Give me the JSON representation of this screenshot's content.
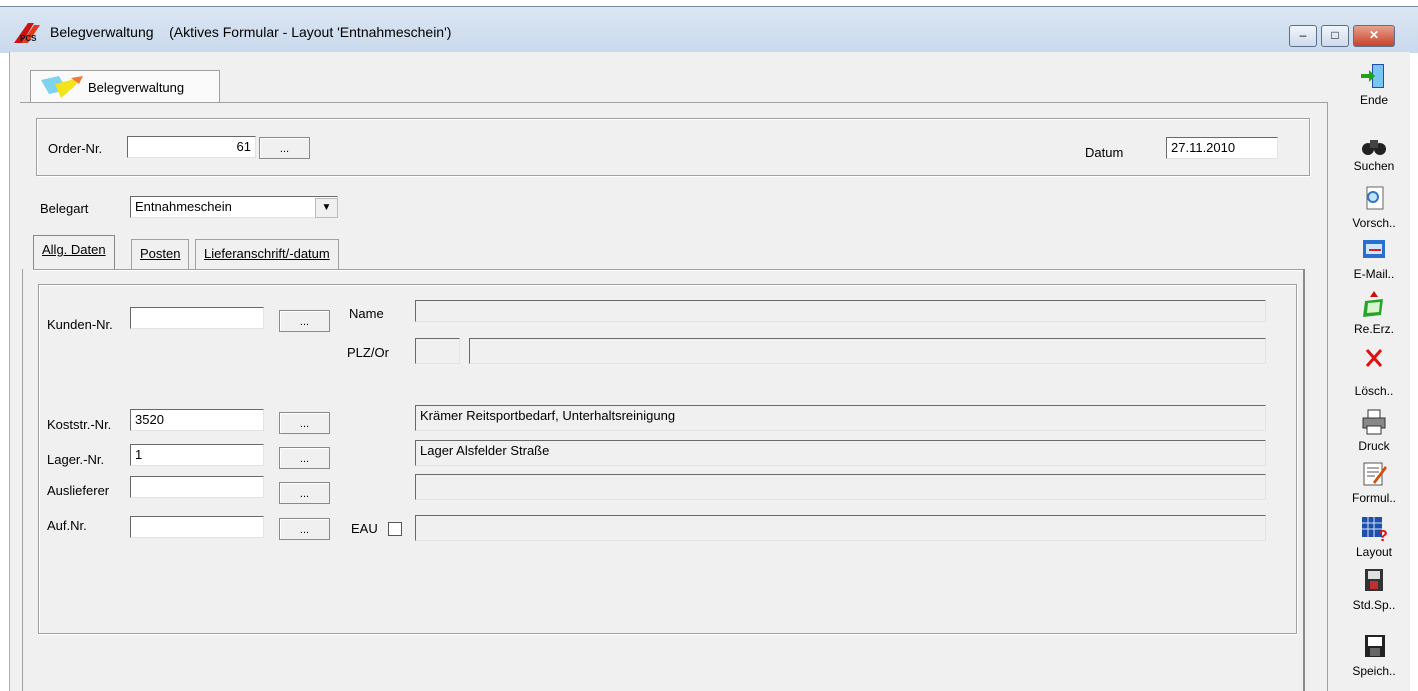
{
  "window": {
    "title": "Belegverwaltung",
    "subtitle": "(Aktives Formular - Layout 'Entnahmeschein')",
    "buttons": {
      "minimize": "–",
      "maximize": "□",
      "close": "✕"
    }
  },
  "top_tab": {
    "label": "Belegverwaltung"
  },
  "header": {
    "order_label": "Order-Nr.",
    "order_value": "61",
    "browse_label": "...",
    "date_label": "Datum",
    "date_value": "27.11.2010"
  },
  "belegart": {
    "label": "Belegart",
    "value": "Entnahmeschein"
  },
  "tabs": [
    "Allg. Daten",
    "Posten",
    "Lieferanschrift/-datum"
  ],
  "form": {
    "kunden_label": "Kunden-Nr.",
    "kunden_value": "",
    "name_label": "Name",
    "name_value": "",
    "plz_label": "PLZ/Or",
    "plz_value": "",
    "ort_value": "",
    "koststnr_label": "Koststr.-Nr.",
    "koststnr_value": "3520",
    "kostst_desc": "Krämer Reitsportbedarf, Unterhaltsreinigung",
    "lager_label": "Lager.-Nr.",
    "lager_value": "1",
    "lager_desc": "Lager Alsfelder Straße",
    "ausl_label": "Auslieferer",
    "ausl_value": "",
    "ausl_desc": "",
    "auf_label": "Auf.Nr.",
    "auf_value": "",
    "eau_label": "EAU",
    "eau_desc": "",
    "browse": "..."
  },
  "toolbar": [
    {
      "label": "Ende",
      "icon": "exit-door-icon"
    },
    {
      "label": "Suchen",
      "icon": "binoculars-icon"
    },
    {
      "label": "Vorsch..",
      "icon": "preview-icon"
    },
    {
      "label": "E-Mail..",
      "icon": "email-icon"
    },
    {
      "label": "Re.Erz.",
      "icon": "invoice-icon"
    },
    {
      "label": "Lösch..",
      "icon": "delete-icon"
    },
    {
      "label": "Druck",
      "icon": "printer-icon"
    },
    {
      "label": "Formul..",
      "icon": "form-icon"
    },
    {
      "label": "Layout",
      "icon": "layout-icon"
    },
    {
      "label": "Std.Sp..",
      "icon": "std-save-icon"
    },
    {
      "label": "Speich..",
      "icon": "save-icon"
    }
  ],
  "colors": {
    "accent_red": "#cc1111",
    "title_bg": "#c9d9ec",
    "panel": "#f0f0f0"
  }
}
